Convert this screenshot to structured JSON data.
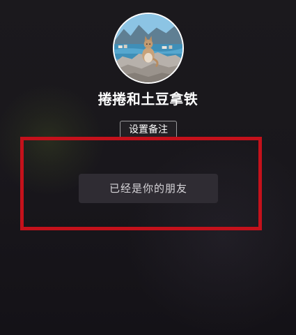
{
  "profile": {
    "avatar_icon": "cat-on-cliff-avatar",
    "username": "捲捲和土豆拿铁"
  },
  "actions": {
    "set_remark_label": "设置备注"
  },
  "status": {
    "friend_label": "已经是你的朋友",
    "highlight_color": "#c4111b"
  }
}
